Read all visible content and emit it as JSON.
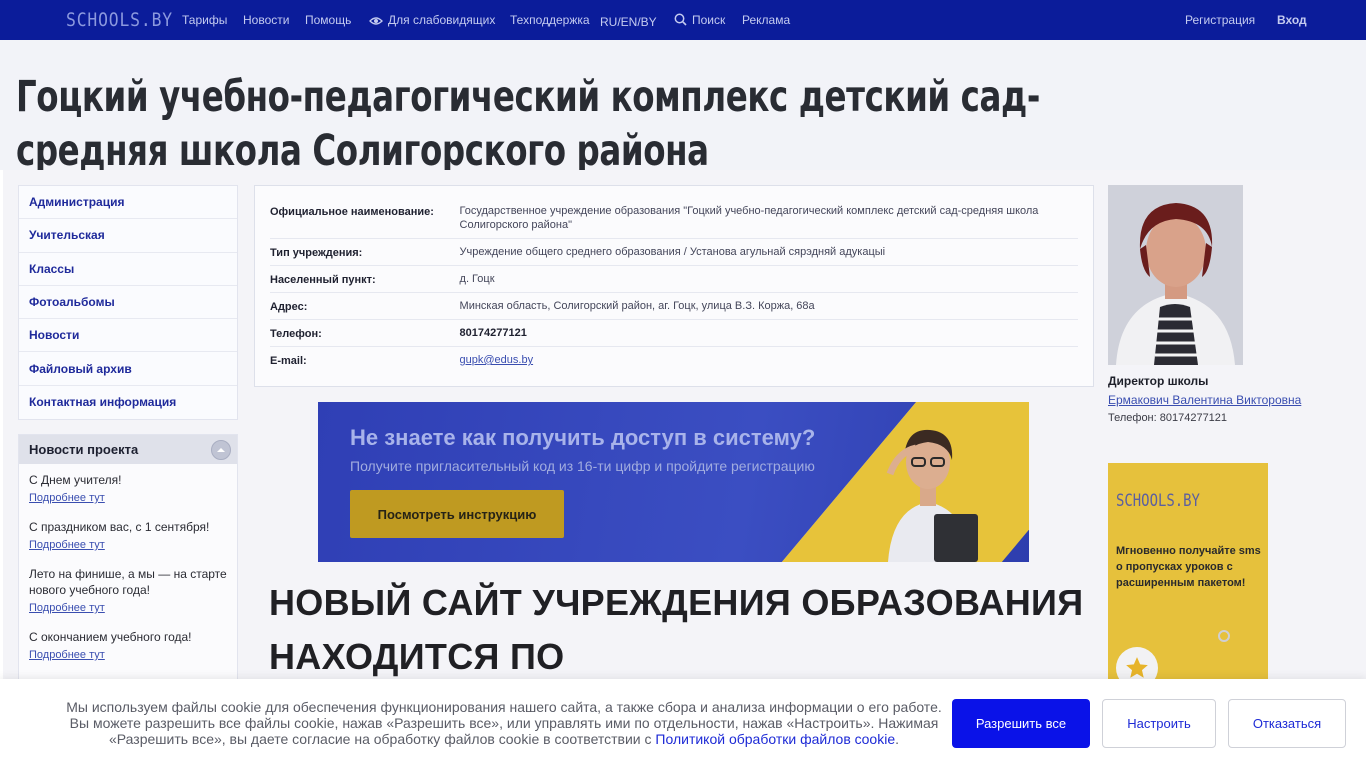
{
  "topbar": {
    "logo": "SCHOOLS.BY",
    "nav": [
      "Тарифы",
      "Новости",
      "Помощь",
      "Для слабовидящих",
      "Техподдержка",
      "RU/EN/BY",
      "Поиск",
      "Реклама"
    ],
    "register": "Регистрация",
    "login": "Вход"
  },
  "page": {
    "title": "Гоцкий учебно-педагогический комплекс детский сад-средняя школа Солигорского района"
  },
  "sidebar": {
    "menu": [
      "Администрация",
      "Учительская",
      "Классы",
      "Фотоальбомы",
      "Новости",
      "Файловый архив",
      "Контактная информация"
    ],
    "news_title": "Новости проекта",
    "news": [
      {
        "text": "С Днем учителя!",
        "more": "Подробнее тут"
      },
      {
        "text": "С праздником вас, с 1 сентября!",
        "more": "Подробнее тут"
      },
      {
        "text": "Лето на финише, а мы — на старте нового учебного года!",
        "more": "Подробнее тут"
      },
      {
        "text": "С окончанием учебного года!",
        "more": "Подробнее тут"
      }
    ]
  },
  "info": {
    "rows": [
      {
        "label": "Официальное наименование:",
        "value": "Государственное учреждение образования \"Гоцкий учебно-педагогический комплекс детский сад-средняя школа Солигорского района\""
      },
      {
        "label": "Тип учреждения:",
        "value": "Учреждение общего среднего образования / Установа агульнай сярэдняй адукацыі"
      },
      {
        "label": "Населенный пункт:",
        "value": "д. Гоцк"
      },
      {
        "label": "Адрес:",
        "value": "Минская область, Солигорский район, аг. Гоцк, улица В.З. Коржа, 68а"
      },
      {
        "label": "Телефон:",
        "value": "80174277121"
      },
      {
        "label": "E-mail:",
        "value": "gupk@edus.by"
      }
    ]
  },
  "banner": {
    "heading": "Не знаете как получить доступ в систему?",
    "subtext": "Получите пригласительный код из 16-ти цифр и пройдите регистрацию",
    "button": "Посмотреть инструкцию"
  },
  "main": {
    "heading": "НОВЫЙ САЙТ УЧРЕЖДЕНИЯ ОБРАЗОВАНИЯ НАХОДИТСЯ ПО"
  },
  "director": {
    "role": "Директор школы",
    "name": "Ермакович Валентина Викторовна",
    "phone": "Телефон: 80174277121"
  },
  "ad": {
    "logo": "SCHOOLS.BY",
    "text": "Мгновенно получайте sms о пропусках уроков с расширенным пакетом!"
  },
  "cookie": {
    "text": "Мы используем файлы cookie для обеспечения функционирования нашего сайта, а также сбора и анализа информации о его работе. Вы можете разрешить все файлы cookie, нажав «Разрешить все», или управлять ими по отдельности, нажав «Настроить». Нажимая «Разрешить все», вы даете согласие на обработку файлов cookie в соответствии с ",
    "link": "Политикой обработки файлов cookie",
    "tail": ".",
    "allow": "Разрешить все",
    "configure": "Настроить",
    "reject": "Отказаться"
  },
  "colors": {
    "topbar": "#0b1c9a",
    "primary_button": "#0a12e8",
    "link": "#1d2ad6",
    "ad_yellow": "#e6c13c"
  }
}
